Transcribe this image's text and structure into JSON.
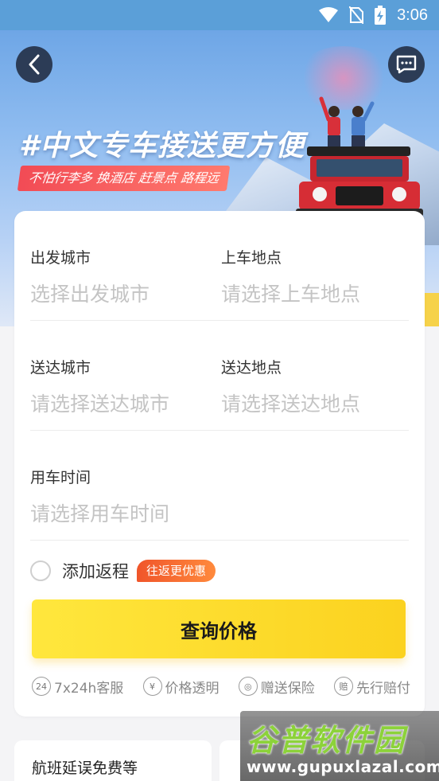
{
  "status_bar": {
    "time": "3:06"
  },
  "hero": {
    "title": "#中文专车接送更方便",
    "tagline": "不怕行李多 换酒店 赶景点 路程远"
  },
  "form": {
    "departure_city": {
      "label": "出发城市",
      "placeholder": "选择出发城市"
    },
    "pickup_location": {
      "label": "上车地点",
      "placeholder": "请选择上车地点"
    },
    "destination_city": {
      "label": "送达城市",
      "placeholder": "请选择送达城市"
    },
    "dropoff_location": {
      "label": "送达地点",
      "placeholder": "请选择送达地点"
    },
    "use_time": {
      "label": "用车时间",
      "placeholder": "请选择用车时间"
    },
    "return_trip": {
      "label": "添加返程",
      "badge": "往返更优惠",
      "checked": false
    },
    "query_button": "查询价格"
  },
  "features": [
    {
      "icon": "24h-service-icon",
      "glyph": "24",
      "text": "7x24h客服"
    },
    {
      "icon": "yen-icon",
      "glyph": "¥",
      "text": "价格透明"
    },
    {
      "icon": "insurance-icon",
      "glyph": "◎",
      "text": "赠送保险"
    },
    {
      "icon": "compensation-icon",
      "glyph": "赔",
      "text": "先行赔付"
    }
  ],
  "bottom_cards": [
    {
      "text": "航班延误免费等"
    },
    {
      "text": ""
    }
  ],
  "watermark": {
    "brand": "谷普软件园",
    "url": "www.gupuxlazal.com"
  },
  "colors": {
    "accent_yellow": "#fbd21f",
    "promo_orange": "#f0552a",
    "tagline_red": "#f24b55"
  }
}
